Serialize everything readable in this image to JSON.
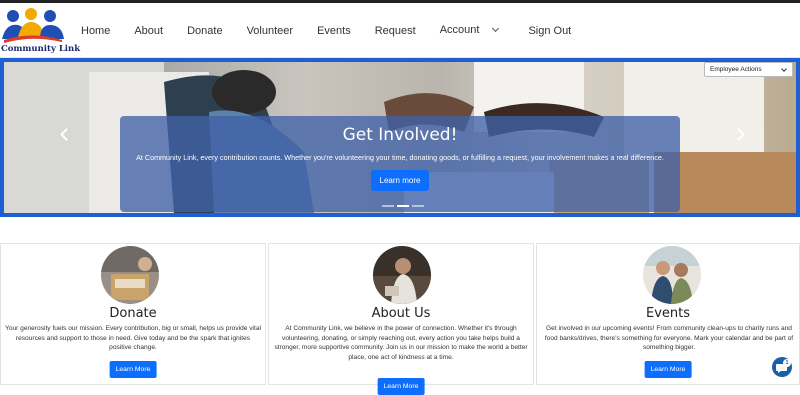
{
  "brand": {
    "name": "Community Link",
    "logo_icon": "people-group-logo"
  },
  "nav": {
    "items": [
      "Home",
      "About",
      "Donate",
      "Volunteer",
      "Events",
      "Request"
    ],
    "account_label": "Account",
    "signout_label": "Sign Out"
  },
  "employee_actions": {
    "selected": "Employee Actions"
  },
  "hero": {
    "title": "Get Involved!",
    "text": "At Community Link, every contribution counts. Whether you're volunteering your time, donating goods, or fulfilling a request, your involvement makes a real difference.",
    "button": "Learn more",
    "slides": 3,
    "active_slide": 1
  },
  "cards": [
    {
      "title": "Donate",
      "text": "Your generosity fuels our mission. Every contribution, big or small, helps us provide vital resources and support to those in need. Give today and be the spark that ignites positive change.",
      "button": "Learn More",
      "image_icon": "donation-box-photo"
    },
    {
      "title": "About Us",
      "text": "At Community Link, we believe in the power of connection. Whether it's through volunteering, donating, or simply reaching out, every action you take helps build a stronger, more supportive community. Join us in our mission to make the world a better place, one act of kindness at a time.",
      "button": "Learn More",
      "image_icon": "volunteer-photo"
    },
    {
      "title": "Events",
      "text": "Get involved in our upcoming events! From community clean-ups to charity runs and food banks/drives, there's something for everyone. Mark your calendar and be part of something bigger.",
      "button": "Learn More",
      "image_icon": "community-event-photo"
    }
  ],
  "chat": {
    "badge": "1",
    "icon": "chat-icon"
  },
  "colors": {
    "accent": "#0d6efd",
    "hero_border": "#1f5fd1",
    "brand_text": "#1a2a6c"
  }
}
